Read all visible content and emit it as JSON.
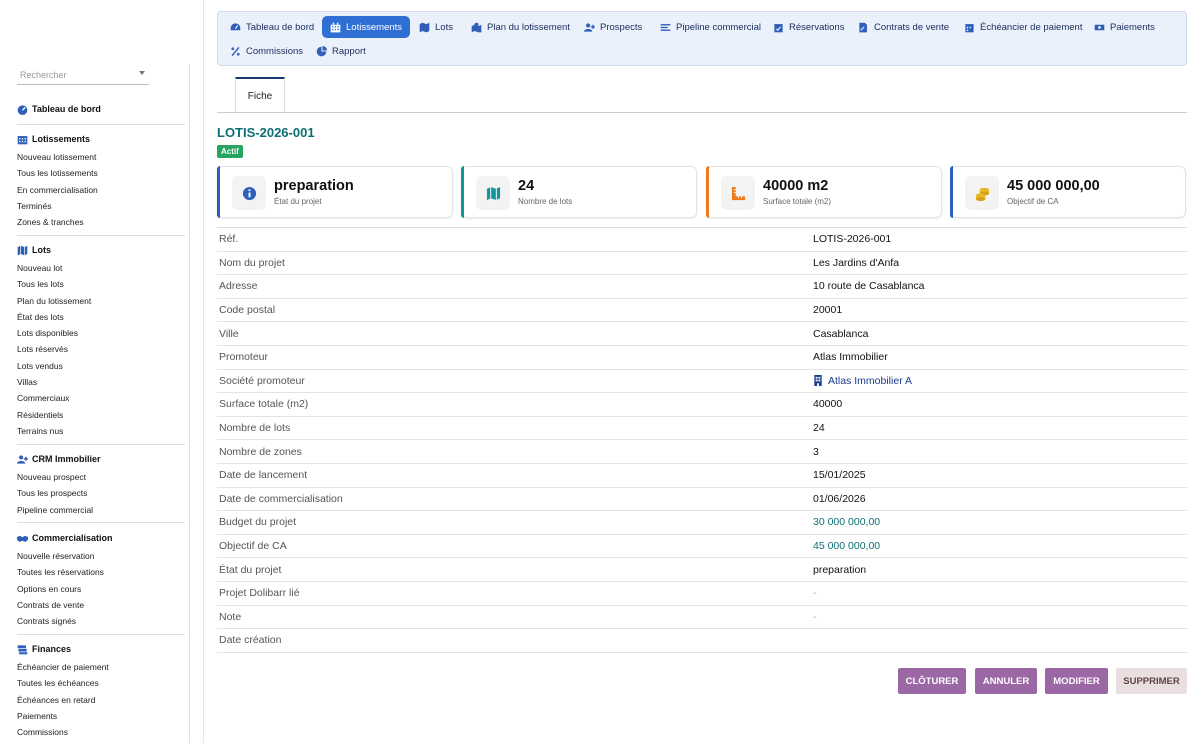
{
  "sidebar": {
    "search_placeholder": "Rechercher",
    "dashboard": "Tableau de bord",
    "sections": [
      {
        "title": "Lotissements",
        "items": [
          "Nouveau lotissement",
          "Tous les lotissements",
          "En commercialisation",
          "Terminés",
          "Zones & tranches"
        ]
      },
      {
        "title": "Lots",
        "items": [
          "Nouveau lot",
          "Tous les lots",
          "Plan du lotissement",
          "État des lots",
          "Lots disponibles",
          "Lots réservés",
          "Lots vendus",
          "Villas",
          "Commerciaux",
          "Résidentiels",
          "Terrains nus"
        ]
      },
      {
        "title": "CRM Immobilier",
        "items": [
          "Nouveau prospect",
          "Tous les prospects",
          "Pipeline commercial"
        ]
      },
      {
        "title": "Commercialisation",
        "items": [
          "Nouvelle réservation",
          "Toutes les réservations",
          "Options en cours",
          "Contrats de vente",
          "Contrats signés"
        ]
      },
      {
        "title": "Finances",
        "items": [
          "Échéancier de paiement",
          "Toutes les échéances",
          "Échéances en retard",
          "Paiements",
          "Commissions"
        ]
      }
    ]
  },
  "topnav": {
    "items": [
      "Tableau de bord",
      "Lotissements",
      "Lots",
      "Plan du lotissement",
      "Prospects",
      "Pipeline commercial",
      "Réservations",
      "Contrats de vente",
      "Échéancier de paiement",
      "Paiements",
      "Commissions",
      "Rapport"
    ],
    "active": "Lotissements"
  },
  "tab": {
    "label": "Fiche"
  },
  "record": {
    "ref": "LOTIS-2026-001",
    "status": "Actif"
  },
  "cards": [
    {
      "value": "preparation",
      "label": "État du projet",
      "color": "#2f5fb8",
      "icon": "info-icon"
    },
    {
      "value": "24",
      "label": "Nombre de lots",
      "color": "#15959a",
      "icon": "map-icon"
    },
    {
      "value": "40000 m2",
      "label": "Surface totale (m2)",
      "color": "#f07a1a",
      "icon": "ruler-icon"
    },
    {
      "value": "45 000 000,00",
      "label": "Objectif de CA",
      "color": "#2f5fb8",
      "icon": "coins-icon"
    }
  ],
  "fields": [
    {
      "label": "Réf.",
      "value": "LOTIS-2026-001"
    },
    {
      "label": "Nom du projet",
      "value": "Les Jardins d'Anfa"
    },
    {
      "label": "Adresse",
      "value": "10 route de Casablanca"
    },
    {
      "label": "Code postal",
      "value": "20001"
    },
    {
      "label": "Ville",
      "value": "Casablanca"
    },
    {
      "label": "Promoteur",
      "value": "Atlas Immobilier"
    },
    {
      "label": "Société promoteur",
      "value": "Atlas Immobilier A"
    },
    {
      "label": "Surface totale (m2)",
      "value": "40000"
    },
    {
      "label": "Nombre de lots",
      "value": "24"
    },
    {
      "label": "Nombre de zones",
      "value": "3"
    },
    {
      "label": "Date de lancement",
      "value": "15/01/2025"
    },
    {
      "label": "Date de commercialisation",
      "value": "01/06/2026"
    },
    {
      "label": "Budget du projet",
      "value": "30 000 000,00"
    },
    {
      "label": "Objectif de CA",
      "value": "45 000 000,00"
    },
    {
      "label": "État du projet",
      "value": "preparation"
    },
    {
      "label": "Projet Dolibarr lié",
      "value": "-"
    },
    {
      "label": "Note",
      "value": "-"
    },
    {
      "label": "Date création",
      "value": ""
    }
  ],
  "actions": {
    "close": "Clôturer",
    "cancel": "Annuler",
    "modify": "Modifier",
    "delete": "Supprimer"
  }
}
